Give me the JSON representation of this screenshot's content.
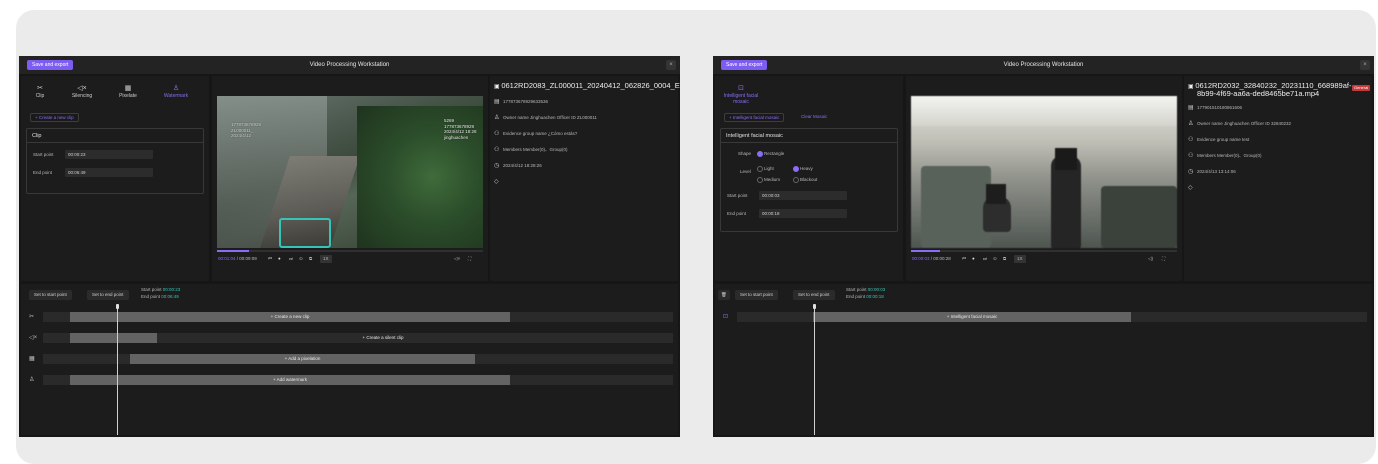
{
  "left_window": {
    "save_label": "Save and export",
    "title": "Video Processing Workstation",
    "close_glyph": "×",
    "tools": [
      {
        "label": "Clip",
        "icon": "scissors-icon",
        "glyph": "✂"
      },
      {
        "label": "Silencing",
        "icon": "speaker-icon",
        "glyph": "◁×"
      },
      {
        "label": "Pixelate",
        "icon": "grid-icon",
        "glyph": "▦"
      },
      {
        "label": "Watermark",
        "icon": "stamp-icon",
        "glyph": "♙"
      }
    ],
    "create_clip_label": "+ Create a new clip",
    "clip_box": {
      "heading": "Clip",
      "start_label": "Start point",
      "start_value": "00:00:23",
      "end_label": "End point",
      "end_value": "00:06:49"
    },
    "watermark_lines": [
      "5269",
      "177873678929",
      "2024/4/12 18:28",
      "jinghuachen"
    ],
    "watermark_left_lines": [
      "",
      "177873678929",
      "ZL000011_",
      "2024/4/12",
      "18:28:..."
    ],
    "player": {
      "time_current": "00:01:04",
      "time_total": "00:09:09",
      "speed": "1X"
    },
    "info": {
      "title": "0612RD2083_ZL000011_20240412_062826_0004_ENC",
      "id_line": "177873678929633536",
      "owner_line": "Owner name Jinghuachen    Officer ID ZL000011",
      "group_line": "Evidence group name ¿Cómo estás?",
      "members_line": "Members Member(0)、Group(0)",
      "time_line": "2024/4/12 18:28:26"
    },
    "timeline": {
      "set_start_label": "Set to start point",
      "set_end_label": "Set to end point",
      "start_label": "Start point",
      "start_value": "00:00:23",
      "end_label": "End point",
      "end_value": "00:06:49",
      "tracks": [
        {
          "icon": "scissors-icon",
          "glyph": "✂",
          "label": "+ Create a new clip"
        },
        {
          "icon": "speaker-icon",
          "glyph": "◁×",
          "label": "+ Create a silent clip"
        },
        {
          "icon": "grid-icon",
          "glyph": "▦",
          "label": "+ Add a pixelation"
        },
        {
          "icon": "stamp-icon",
          "glyph": "♙",
          "label": "+ Add watermark"
        }
      ]
    }
  },
  "right_window": {
    "save_label": "Save and export",
    "title": "Video Processing Workstation",
    "close_glyph": "×",
    "tool": {
      "label": "Intelligent facial mosaic",
      "icon": "face-mosaic-icon",
      "glyph": "⊡"
    },
    "create_label": "+ Intelligent facial mosaic",
    "clear_label": "Clear Mosaic",
    "mosaic_box": {
      "heading": "Intelligent facial mosaic",
      "shape_label": "Shape",
      "shape_option": "Rectangle",
      "level_label": "Level",
      "levels": [
        "Light",
        "Heavy",
        "Medium",
        "Blackout"
      ],
      "start_label": "Start point",
      "start_value": "00:00:03",
      "end_label": "End point",
      "end_value": "00:00:18"
    },
    "player": {
      "time_current": "00:00:03",
      "time_total": "00:00:28",
      "speed": "1X"
    },
    "info": {
      "title_line1": "0612RD2032_32840232_20231110_668989af-",
      "title_line2": "8b99-4f69-aa6a-ded8465be71a.mp4",
      "badge": "General",
      "id_line": "177901510180861606",
      "owner_line": "Owner name Jinghuachen    Officer ID 32840232",
      "group_line": "Evidence group name test",
      "members_line": "Members Member(0)、Group(0)",
      "time_line": "2024/4/13 13:14:06"
    },
    "timeline": {
      "set_start_label": "Set to start point",
      "set_end_label": "Set to end point",
      "start_label": "Start point",
      "start_value": "00:00:03",
      "end_label": "End point",
      "end_value": "00:00:18",
      "tracks": [
        {
          "icon": "face-mosaic-icon",
          "glyph": "⊡",
          "label": "+ Intelligent facial mosaic"
        }
      ]
    }
  },
  "colors": {
    "accent": "#8b6cf5",
    "bg": "#161616",
    "panel": "#1c1c1c",
    "segment": "#636363"
  }
}
